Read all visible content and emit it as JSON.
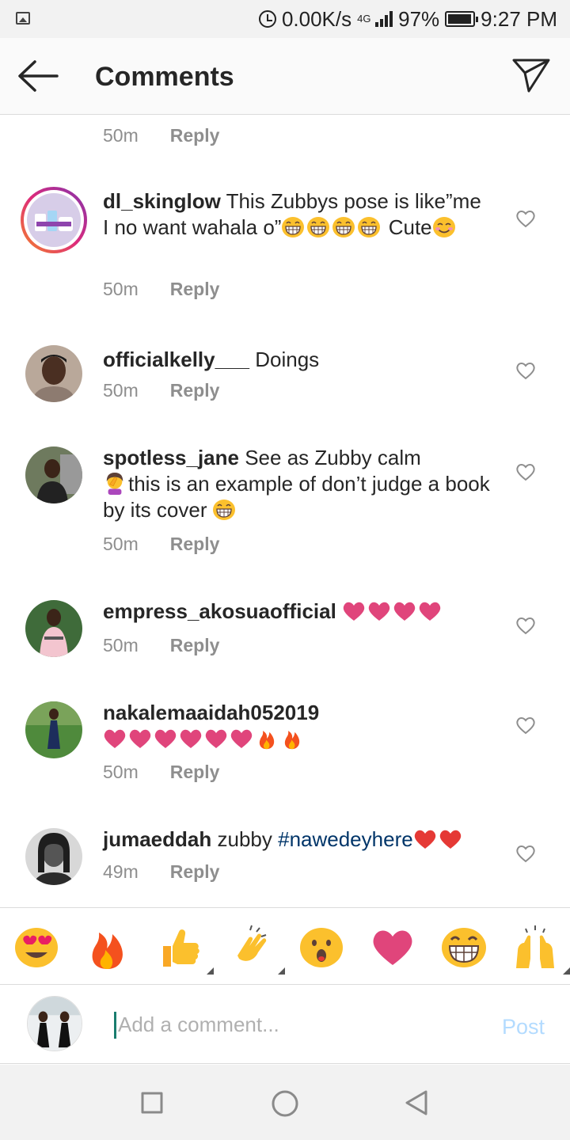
{
  "status_bar": {
    "speed": "0.00K/s",
    "network": "4G",
    "battery_pct": "97%",
    "battery_level": 0.97,
    "time": "9:27 PM"
  },
  "header": {
    "title": "Comments"
  },
  "top_meta": {
    "time": "50m",
    "reply": "Reply"
  },
  "comments": [
    {
      "user": "dl_skinglow",
      "text_before": "This Zubbys pose is like”me I no want wahala o”",
      "text_after": "Cute",
      "time": "50m",
      "reply": "Reply",
      "emojis": [
        "grin-emoji",
        "grin-emoji",
        "grin-emoji",
        "grin-emoji"
      ],
      "emojis_after": [
        "smile-emoji"
      ]
    },
    {
      "user": "officialkelly___",
      "text": "Doings",
      "time": "50m",
      "reply": "Reply"
    },
    {
      "user": "spotless_jane",
      "text_a": "See as Zubby calm",
      "text_b": "this is an example of don’t judge a book by its cover",
      "time": "50m",
      "reply": "Reply"
    },
    {
      "user": "empress_akosuaofficial",
      "text": "",
      "time": "50m",
      "reply": "Reply"
    },
    {
      "user": "nakalemaaidah052019",
      "text": "",
      "time": "50m",
      "reply": "Reply"
    },
    {
      "user": "jumaeddah",
      "text": "zubby",
      "hashtag": "#nawedeyhere",
      "time": "49m",
      "reply": "Reply"
    }
  ],
  "emoji_bar": [
    "heart-eyes-emoji",
    "fire-emoji",
    "thumbs-up-emoji",
    "clapping-emoji",
    "surprised-emoji",
    "heart-emoji",
    "grin-emoji",
    "raised-hands-emoji"
  ],
  "composer": {
    "placeholder": "Add a comment...",
    "post_label": "Post"
  },
  "colors": {
    "accent_link": "#003569",
    "post_disabled": "#b3dbff",
    "heart_pink": "#e0457b",
    "story_ring_start": "#f58529",
    "story_ring_end": "#c13584"
  }
}
